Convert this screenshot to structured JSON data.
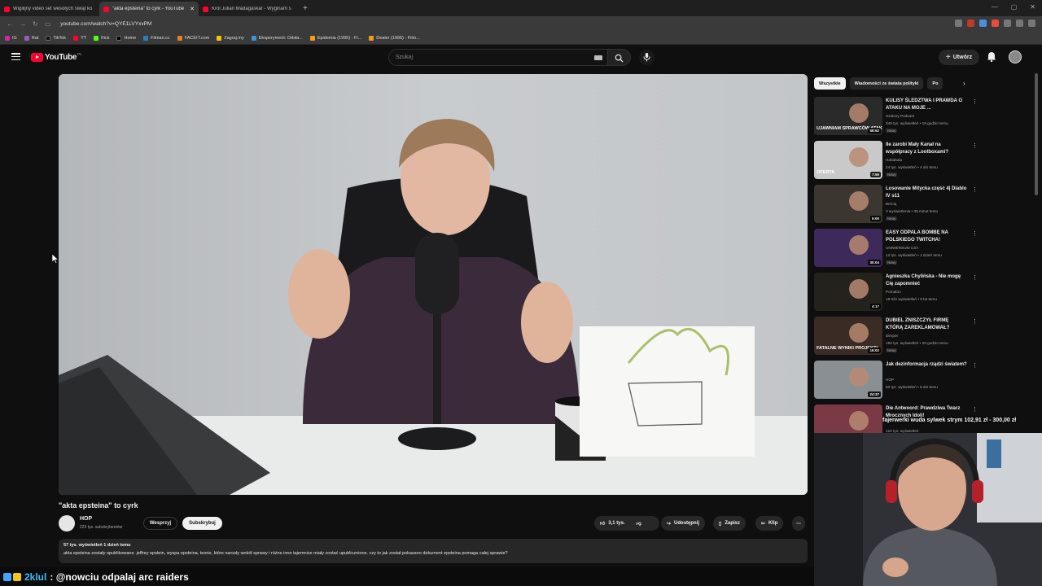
{
  "browser": {
    "tabs": [
      {
        "title": "Wigilijny video set wesołych świąt ko"
      },
      {
        "title": "\"akta epsteina\" to cyrk - YouTube",
        "active": true
      },
      {
        "title": "Król Julian Madagaskar - Wyginam ś"
      }
    ],
    "new_tab": "+",
    "address": "youtube.com/watch?v=QYE1LVYxvPM",
    "bookmarks": [
      "IG",
      "Rat",
      "TikTok",
      "YT",
      "Kick",
      "Home",
      "Filman.cc",
      "FACEIT.com",
      "Zagraj.my",
      "Eksperyment: Odsła...",
      "Epidemia (1995) - Fi...",
      "Dealer (1996) - Film..."
    ]
  },
  "youtube": {
    "logo_text": "YouTube",
    "country_code": "PL",
    "search_placeholder": "Szukaj",
    "create_label": "Utwórz",
    "icons": [
      "menu-icon",
      "search-icon",
      "mic-icon",
      "bell-icon",
      "keyboard-icon"
    ]
  },
  "video": {
    "title": "\"akta epsteina\" to cyrk",
    "channel": "HOP",
    "subscribers": "223 tys. subskrybentów",
    "join_label": "Wesprzyj",
    "subscribe_label": "Subskrybuj",
    "likes": "3,1 tys.",
    "share_label": "Udostępnij",
    "save_label": "Zapisz",
    "clip_label": "Klip",
    "views_date": "57 tys. wyświetleń  1 dzień temu",
    "description": "akta epsteina zostały opublikowane. jeffrey epstein, wyspa epsteina, teorie, które narosły wokół sprawy i różne inne tajemnice miały zostać upublicznione. czy to jak został pokazano dokument epsteina pomaga całej sprawie?"
  },
  "chips": [
    "Wszystkie",
    "Wiadomości ze świata polityki",
    "Po"
  ],
  "recommendations": [
    {
      "title": "KULISY ŚLEDZTWA I PRAWDA O ATAKU NA MOJE ...",
      "channel": "Szalony Podcast",
      "meta": "349 tys. wyświetleń • 19 godzin temu",
      "badge": "Nowy",
      "duration": "58:52",
      "thumb_color": "#2a2a2a",
      "thumb_text": "UJAWNIAM SPRAWCÓW ATAKU NA MÓJ DOM"
    },
    {
      "title": "Ile zarobi Mały Kanał na współpracy z Lootboxami?",
      "channel": "Hababala",
      "meta": "24 tys. wyświetleń • 4 dni temu",
      "badge": "Nowy",
      "duration": "7:59",
      "thumb_color": "#c9c9c9",
      "thumb_text": "OFERTA"
    },
    {
      "title": "Losowanie Mitycka część 4| Diablo IV s11",
      "channel": "Bercią",
      "meta": "3 wyświetlenia • 35 minut temu",
      "badge": "Nowy",
      "duration": "5:00",
      "thumb_color": "#3b3730",
      "thumb_text": ""
    },
    {
      "title": "EASY ODPALA BOMBĘ NA POLSKIEGO TWITCHA!",
      "channel": "UNIWERSUM CSA",
      "meta": "12 tys. wyświetleń • 1 dzień temu",
      "badge": "Nowy",
      "duration": "30:04",
      "thumb_color": "#3d2a5a",
      "thumb_text": ""
    },
    {
      "title": "Agnieszka Chylińska - Nie mogę Cię zapomnieć",
      "channel": "Pomaton",
      "meta": "18 mln wyświetleń • 9 lat temu",
      "badge": "",
      "duration": "4:17",
      "thumb_color": "#24221c",
      "thumb_text": ""
    },
    {
      "title": "DUBIEL ZNISZCZYŁ FIRMĘ KTÓRĄ ZAREKLAMOWAŁ?",
      "channel": "Dimper",
      "meta": "192 tys. wyświetleń • 20 godzin temu",
      "badge": "Nowy",
      "duration": "16:02",
      "thumb_color": "#3a2b24",
      "thumb_text": "FATALNE WYNIKI PROJEKT!"
    },
    {
      "title": "Jak dezinformacja rządzi światem?",
      "channel": "HOP",
      "meta": "50 tys. wyświetleń • 8 dni temu",
      "badge": "",
      "duration": "24:37",
      "thumb_color": "#8a8f94",
      "thumb_text": ""
    },
    {
      "title": "Die Antwoord: Prawdziwa Twarz Mrocznych Idoli!",
      "channel": "",
      "meta": "122 tys. wyświetleń",
      "badge": "",
      "duration": "",
      "thumb_color": "#7a3a45",
      "thumb_text": ""
    }
  ],
  "overlay": {
    "donation": "fajerwerki wuda sylwek strym 102,91 zł - 300,00 zł",
    "chat_user": "2klul",
    "chat_message": ": @nowciu odpalaj arc raiders"
  },
  "colors": {
    "accent": "#ff0033",
    "bg": "#0f0f0f",
    "chip": "#272727",
    "chat_name": "#38bdf8"
  }
}
